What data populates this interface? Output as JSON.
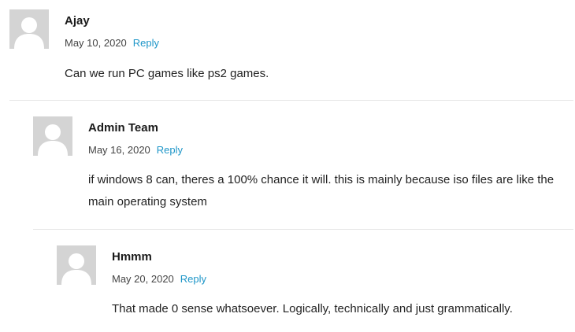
{
  "comments": [
    {
      "author": "Ajay",
      "date": "May 10, 2020",
      "reply_label": "Reply",
      "text": "Can we run PC games like ps2 games."
    },
    {
      "author": "Admin Team",
      "date": "May 16, 2020",
      "reply_label": "Reply",
      "text": "if windows 8 can, theres a 100% chance it will. this is mainly because iso files are like the main operating system"
    },
    {
      "author": "Hmmm",
      "date": "May 20, 2020",
      "reply_label": "Reply",
      "text": "That made 0 sense whatsoever. Logically, technically and just grammatically."
    }
  ],
  "icons": {
    "avatar": "default-user-avatar-icon"
  },
  "colors": {
    "reply_link": "#1e96c8",
    "avatar_bg": "#d4d4d4",
    "divider": "#e6e6e6"
  }
}
